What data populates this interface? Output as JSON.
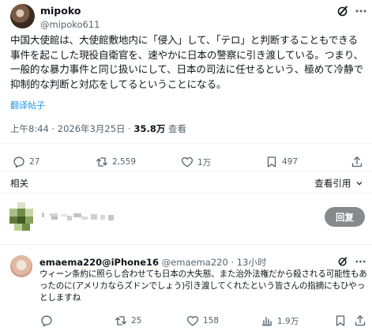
{
  "post": {
    "author_name": "mipoko",
    "author_handle": "@mipoko611",
    "text": "中国大使館は、大使館敷地内に「侵入」して、「テロ」と判断することもできる事件を起こした現役自衛官を、速やかに日本の警察に引き渡している。つまり、一般的な暴力事件と同じ扱いにして、日本の司法に任せるという、極めて冷静で抑制的な判断と対応をしてるということになる。",
    "translate_label": "翻译帖子",
    "time": "上午8:44 · 2026年3月25日 · ",
    "views_count": "35.8万",
    "views_label": " 查看",
    "actions": {
      "replies": "27",
      "reposts": "2,559",
      "likes": "1万",
      "bookmarks": "497"
    }
  },
  "related_label": "相关",
  "view_quotes_label": "查看引用",
  "composer": {
    "reply_button": "回复"
  },
  "reply": {
    "author_name": "emaema220@iPhone16",
    "author_handle": "@emaema220",
    "time": "13小时",
    "text": "ウィーン条約に照らし合わせても日本の大失態、また治外法権だから殺される可能性もあったのに(アメリカならズドンでしょう)引き渡してくれたという皆さんの指摘にもひやっとしますね",
    "actions": {
      "replies": "",
      "reposts": "25",
      "likes": "158",
      "views": "1.9万"
    }
  },
  "icons": [
    "grok-icon",
    "more-icon",
    "reply-icon",
    "repost-icon",
    "like-icon",
    "bookmark-icon",
    "share-icon",
    "views-icon",
    "chevron-down-icon"
  ],
  "colors": {
    "text": "#0f1419",
    "secondary": "#536471",
    "link": "#1d9bf0",
    "divider": "#eff3f4",
    "reply_button_bg": "#87898c"
  }
}
